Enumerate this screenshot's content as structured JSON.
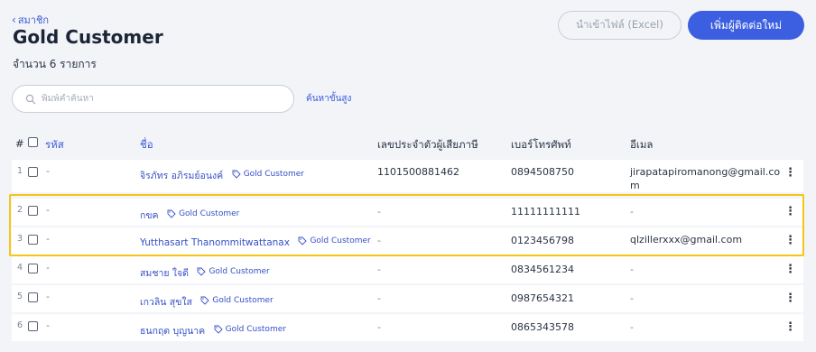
{
  "header": {
    "back_label": "สมาชิก",
    "title": "Gold Customer",
    "count_text": "จำนวน 6 รายการ",
    "import_button": "นำเข้าไฟล์ (Excel)",
    "add_button": "เพิ่มผู้ติดต่อใหม่"
  },
  "search": {
    "placeholder": "พิมพ์คำค้นหา",
    "advanced_label": "ค้นหาขั้นสูง"
  },
  "table": {
    "columns": {
      "index": "#",
      "code": "รหัส",
      "name": "ชื่อ",
      "tax_id": "เลขประจำตัวผู้เสียภาษี",
      "phone": "เบอร์โทรศัพท์",
      "email": "อีเมล"
    },
    "tag_label": "Gold Customer",
    "rows": [
      {
        "num": "1",
        "code": "-",
        "name": "จิรภัทร อภิรมย์อนงค์",
        "tax_id": "1101500881462",
        "phone": "0894508750",
        "email": "jirapatapiromanong@gmail.co",
        "email2": "m"
      },
      {
        "num": "2",
        "code": "-",
        "name": "กขค",
        "tax_id": "-",
        "phone": "11111111111",
        "email": "-"
      },
      {
        "num": "3",
        "code": "-",
        "name": "Yutthasart Thanommitwattanax",
        "tax_id": "-",
        "phone": "0123456798",
        "email": "qlzillerxxx@gmail.com"
      },
      {
        "num": "4",
        "code": "-",
        "name": "สมชาย ใจดี",
        "tax_id": "-",
        "phone": "0834561234",
        "email": "-"
      },
      {
        "num": "5",
        "code": "-",
        "name": "เกวลิน สุขใส",
        "tax_id": "-",
        "phone": "0987654321",
        "email": "-"
      },
      {
        "num": "6",
        "code": "-",
        "name": "ธนกฤต บุญนาค",
        "tax_id": "-",
        "phone": "0865343578",
        "email": "-"
      }
    ]
  }
}
